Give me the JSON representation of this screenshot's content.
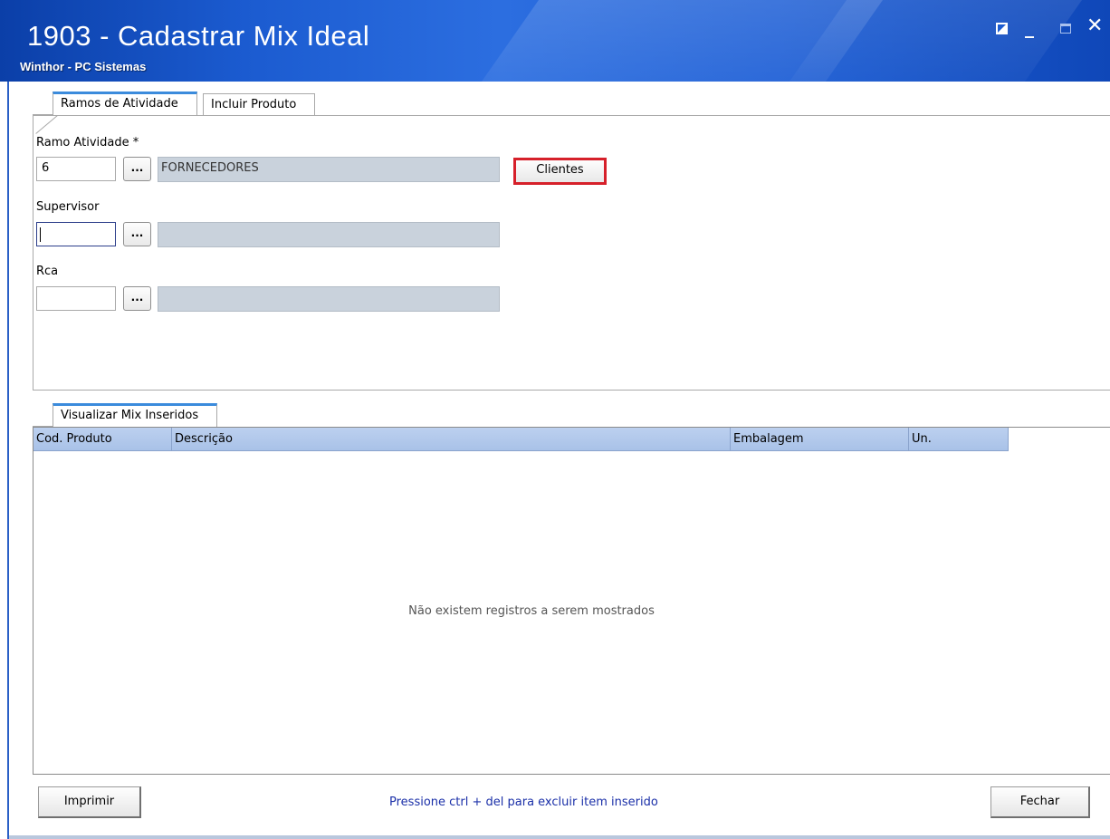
{
  "window": {
    "title": "1903 - Cadastrar Mix Ideal",
    "subtitle": "Winthor - PC Sistemas",
    "close_glyph": "✕",
    "minimize_glyph": "_"
  },
  "tabs_top": [
    {
      "label": "Ramos de Atividade",
      "active": true
    },
    {
      "label": "Incluir Produto",
      "active": false
    }
  ],
  "form": {
    "ramo": {
      "label": "Ramo Atividade *",
      "code": "6",
      "description": "FORNECEDORES",
      "lookup_label": "..."
    },
    "supervisor": {
      "label": "Supervisor",
      "code": "",
      "description": "",
      "lookup_label": "..."
    },
    "rca": {
      "label": "Rca",
      "code": "",
      "description": "",
      "lookup_label": "..."
    },
    "clientes_button": "Clientes"
  },
  "tabs_bottom": [
    {
      "label": "Visualizar Mix Inseridos",
      "active": true
    }
  ],
  "grid": {
    "columns": [
      "Cod. Produto",
      "Descrição",
      "Embalagem",
      "Un."
    ],
    "rows": [],
    "empty_message": "Não existem registros a serem mostrados"
  },
  "footer": {
    "print_button": "Imprimir",
    "hint": "Pressione ctrl + del  para excluir item inserido",
    "close_button": "Fechar"
  },
  "colors": {
    "titlebar": "#1b5bd0",
    "highlight": "#d6202a",
    "grid_header": "#a9c2e8",
    "hint_text": "#1a2fa8"
  }
}
